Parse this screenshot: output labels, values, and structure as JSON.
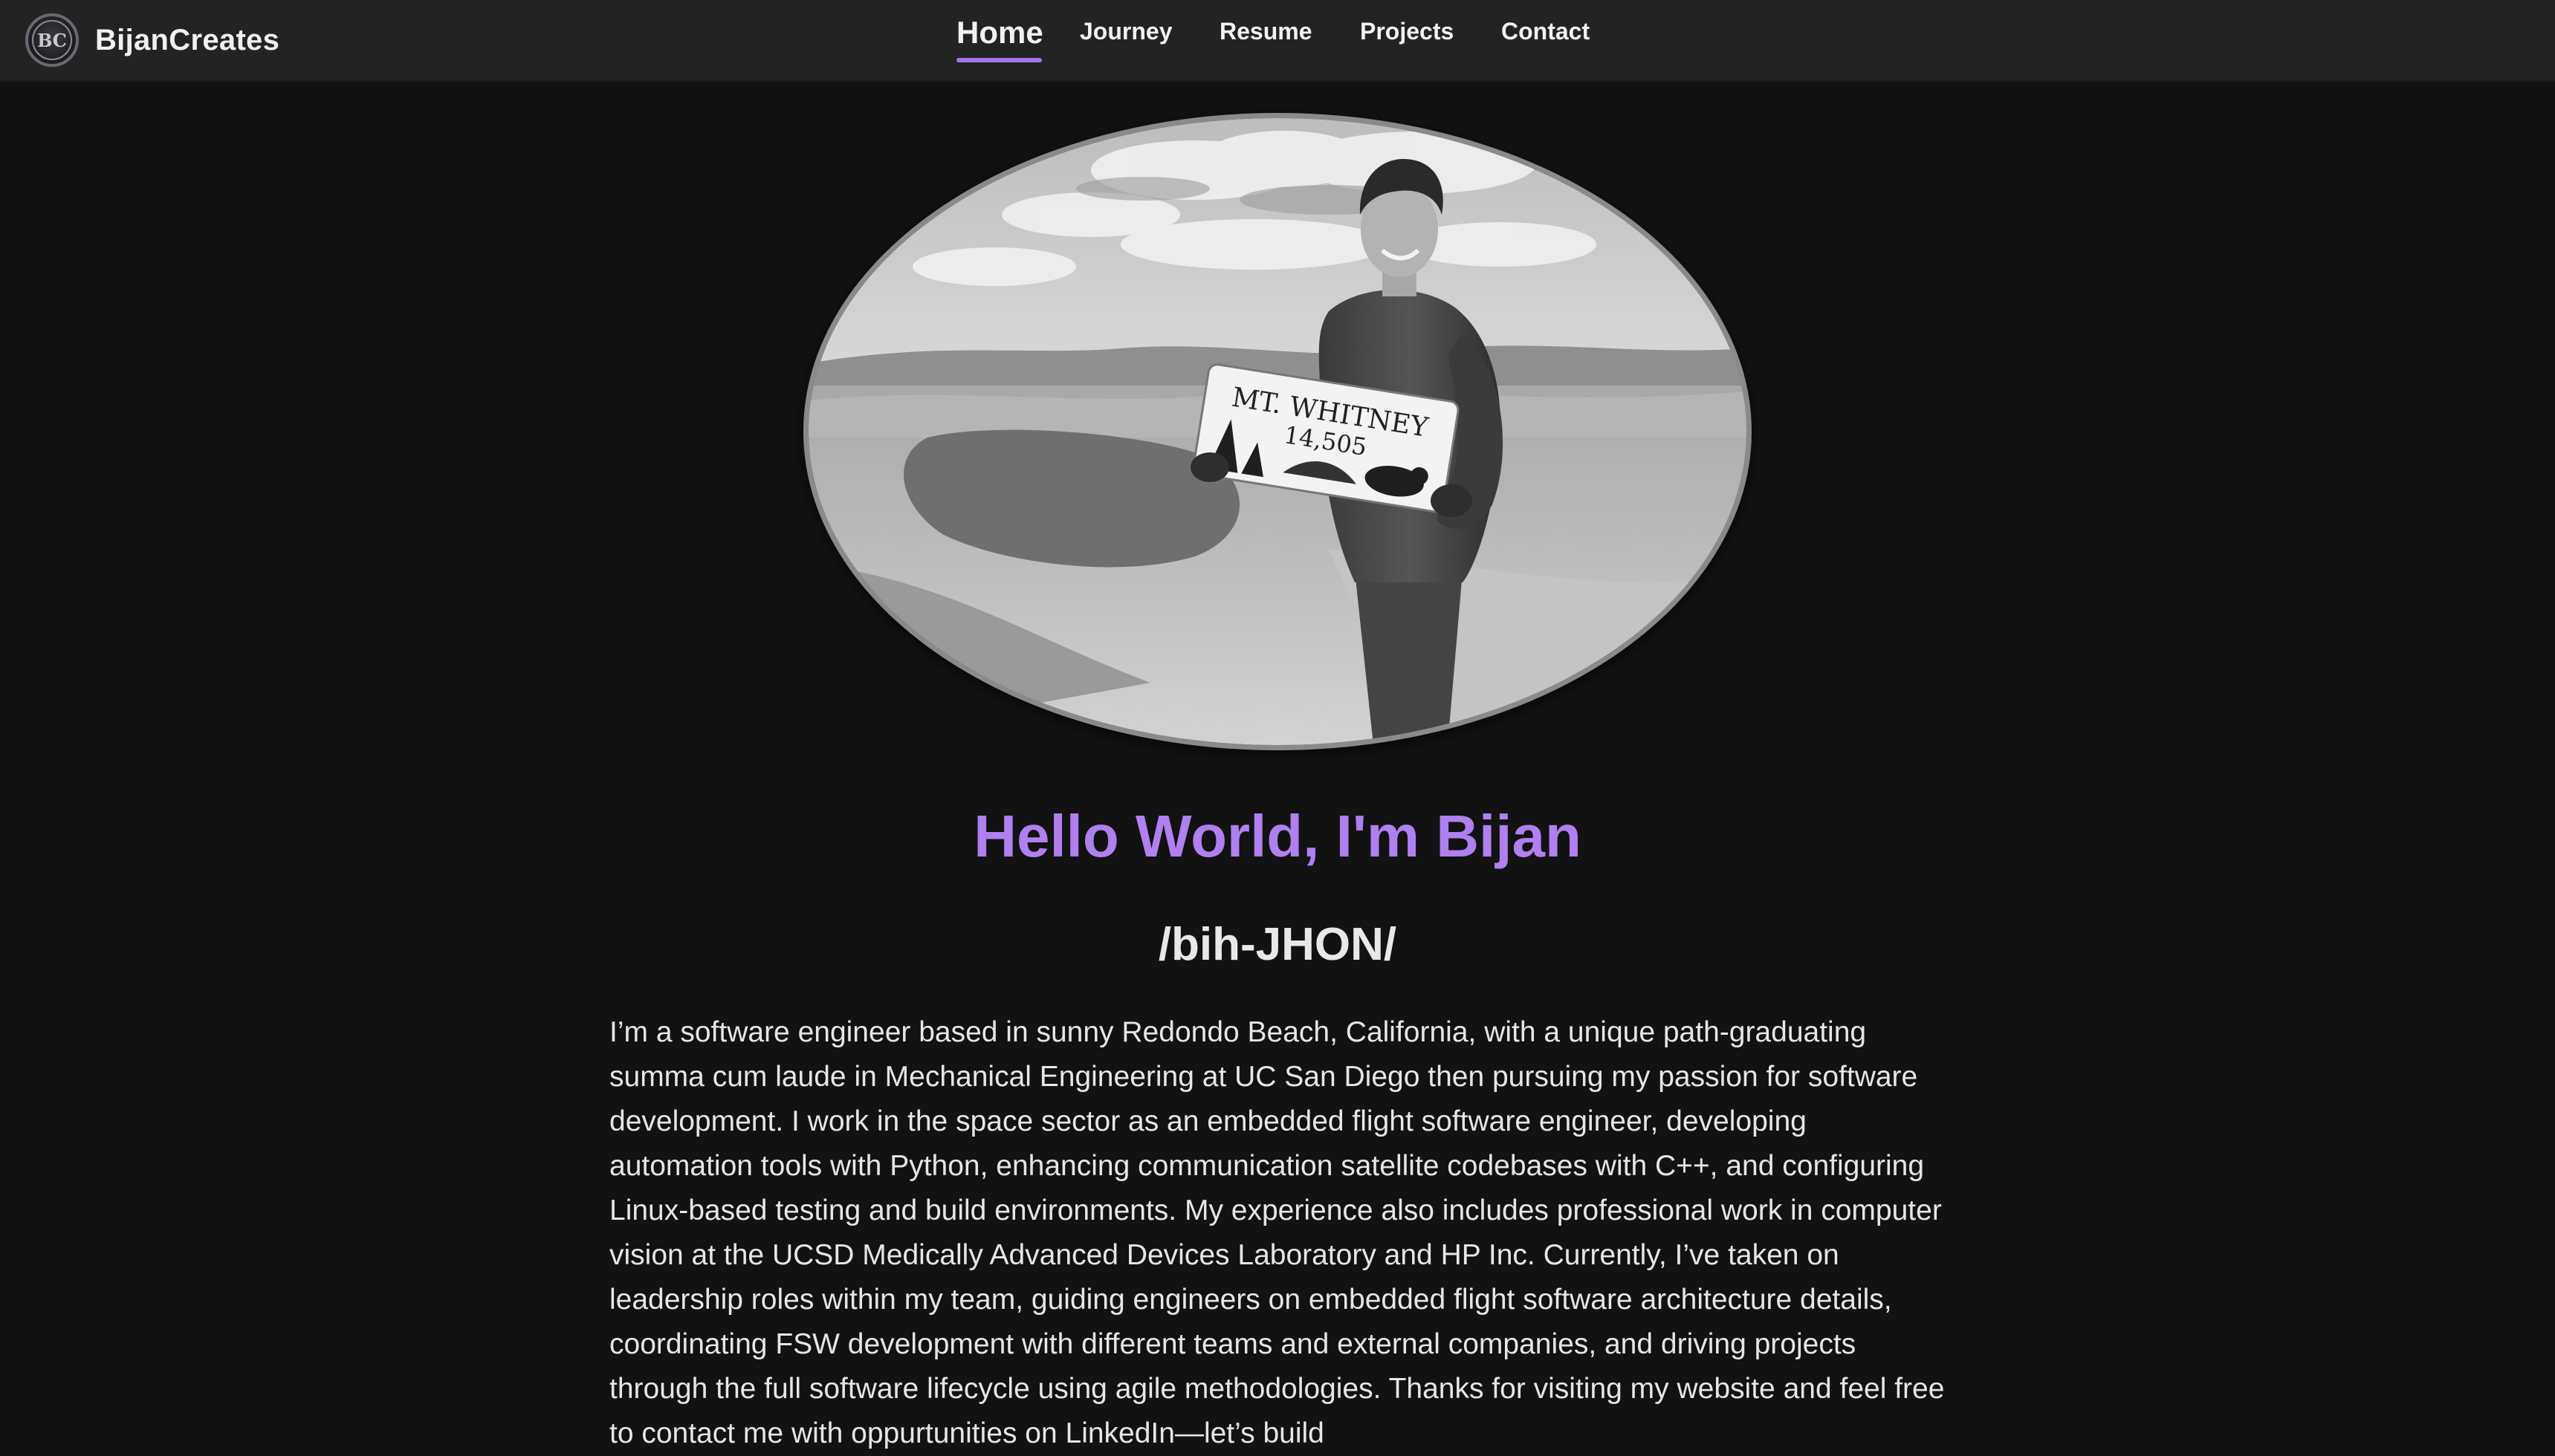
{
  "brand": {
    "name": "BijanCreates",
    "logo_text": "BC"
  },
  "nav": {
    "items": [
      {
        "label": "Home",
        "active": true
      },
      {
        "label": "Journey",
        "active": false
      },
      {
        "label": "Resume",
        "active": false
      },
      {
        "label": "Projects",
        "active": false
      },
      {
        "label": "Contact",
        "active": false
      }
    ]
  },
  "hero": {
    "photo_alt": "Bijan holding a Mt. Whitney summit sign",
    "sign_line1": "MT. WHITNEY",
    "sign_line2": "14,505",
    "title": "Hello World, I'm Bijan",
    "pronunciation": "/bih-JHON/",
    "bio": "I’m a software engineer based in sunny Redondo Beach, California, with a unique path-graduating summa cum laude in Mechanical Engineering at UC San Diego then pursuing my passion for software development. I work in the space sector as an embedded flight software engineer, developing automation tools with Python, enhancing communication satellite codebases with C++, and configuring Linux-based testing and build environments. My experience also includes professional work in computer vision at the UCSD Medically Advanced Devices Laboratory and HP Inc. Currently, I’ve taken on leadership roles within my team, guiding engineers on embedded flight software architecture details, coordinating FSW development with different teams and external companies, and driving projects through the full software lifecycle using agile methodologies. Thanks for visiting my website and feel free to contact me with oppurtunities on LinkedIn—let’s build"
  },
  "colors": {
    "accent": "#b07ff0",
    "underline": "#a874f0",
    "background": "#121212",
    "navbar": "#232323"
  }
}
